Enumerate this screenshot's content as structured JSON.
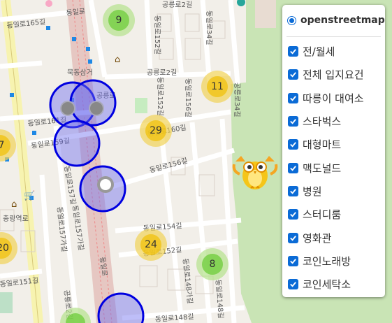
{
  "map": {
    "road_labels": [
      "동일로165길",
      "동일로",
      "공릉로2길",
      "동일로34길",
      "묵동삼거",
      "공릉로2길",
      "공릉로",
      "동일로156길",
      "동일로152길",
      "동일로152길",
      "동일로160길",
      "동일로161길",
      "동일로159길",
      "동일로156길",
      "동일로157길",
      "동일로157가길",
      "동일로157가길",
      "충랑역로",
      "동일로154길",
      "동일로152길",
      "동일로148가길",
      "동일로148길",
      "동일로151길",
      "동일로",
      "공릉로34길",
      "동일로148길",
      "공릉로2길"
    ],
    "clusters": [
      {
        "count": "9",
        "color": "green"
      },
      {
        "count": "11",
        "color": "yellow"
      },
      {
        "count": "29",
        "color": "yellow"
      },
      {
        "count": "7",
        "color": "yellow"
      },
      {
        "count": "20",
        "color": "yellow"
      },
      {
        "count": "24",
        "color": "yellow"
      },
      {
        "count": "8",
        "color": "green"
      }
    ]
  },
  "layer_control": {
    "base_layer": "openstreetmap",
    "overlays": [
      "전/월세",
      "전체 입지요건",
      "따릉이 대여소",
      "스타벅스",
      "대형마트",
      "맥도널드",
      "병원",
      "스터디룸",
      "영화관",
      "코인노래방",
      "코인세탁소"
    ]
  }
}
